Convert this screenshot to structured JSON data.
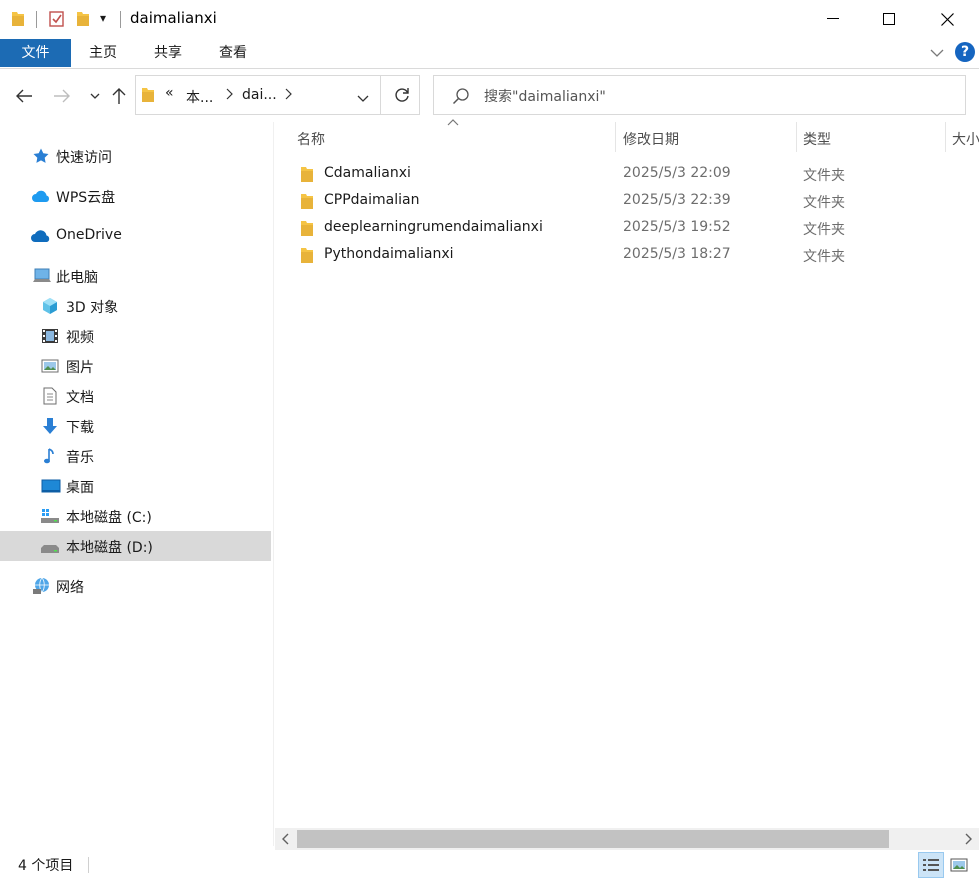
{
  "window": {
    "title": "daimalianxi",
    "qat_dropdown": "▾",
    "controls": {
      "minimize": "—",
      "maximize": "☐",
      "close": "✕"
    }
  },
  "ribbon": {
    "tabs": [
      {
        "label": "文件",
        "active": true
      },
      {
        "label": "主页",
        "active": false
      },
      {
        "label": "共享",
        "active": false
      },
      {
        "label": "查看",
        "active": false
      }
    ],
    "help": "?"
  },
  "nav": {
    "breadcrumb": [
      "«",
      "本...",
      "dai..."
    ],
    "search_placeholder": "搜索\"daimalianxi\""
  },
  "sidebar": {
    "items": [
      {
        "label": "快速访问",
        "icon": "quick-access-star-icon"
      },
      {
        "label": "WPS云盘",
        "icon": "wps-cloud-icon"
      },
      {
        "label": "OneDrive",
        "icon": "onedrive-cloud-icon"
      },
      {
        "label": "此电脑",
        "icon": "this-pc-icon"
      },
      {
        "label": "3D 对象",
        "icon": "3d-objects-icon"
      },
      {
        "label": "视频",
        "icon": "videos-icon"
      },
      {
        "label": "图片",
        "icon": "pictures-icon"
      },
      {
        "label": "文档",
        "icon": "documents-icon"
      },
      {
        "label": "下载",
        "icon": "downloads-icon"
      },
      {
        "label": "音乐",
        "icon": "music-icon"
      },
      {
        "label": "桌面",
        "icon": "desktop-icon"
      },
      {
        "label": "本地磁盘 (C:)",
        "icon": "drive-c-icon"
      },
      {
        "label": "本地磁盘 (D:)",
        "icon": "drive-d-icon",
        "selected": true
      },
      {
        "label": "网络",
        "icon": "network-icon"
      }
    ]
  },
  "content": {
    "columns": {
      "name": "名称",
      "modified": "修改日期",
      "type": "类型",
      "size": "大小"
    },
    "files": [
      {
        "name": "Cdamalianxi",
        "modified": "2025/5/3 22:09",
        "type": "文件夹"
      },
      {
        "name": "CPPdaimalian",
        "modified": "2025/5/3 22:39",
        "type": "文件夹"
      },
      {
        "name": "deeplearningrumendaimalianxi",
        "modified": "2025/5/3 19:52",
        "type": "文件夹"
      },
      {
        "name": "Pythondaimalianxi",
        "modified": "2025/5/3 18:27",
        "type": "文件夹"
      }
    ]
  },
  "status": {
    "item_count": "4 个项目"
  },
  "colors": {
    "accent": "#1c6bb4",
    "folder": "#f5c445",
    "selection": "#d9d9d9"
  }
}
